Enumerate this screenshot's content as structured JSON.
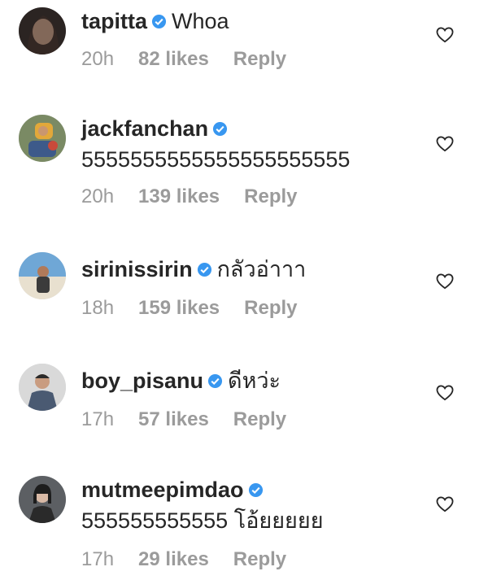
{
  "comments": [
    {
      "username": "tapitta",
      "text_inline": "Whoa",
      "text_below": "",
      "time": "20h",
      "likes": "82 likes",
      "reply": "Reply"
    },
    {
      "username": "jackfanchan",
      "text_inline": "",
      "text_below": "5555555555555555555555",
      "time": "20h",
      "likes": "139 likes",
      "reply": "Reply"
    },
    {
      "username": "sirinissirin",
      "text_inline": "กลัวอ่าาา",
      "text_below": "",
      "time": "18h",
      "likes": "159 likes",
      "reply": "Reply"
    },
    {
      "username": "boy_pisanu",
      "text_inline": "ดีหว่ะ",
      "text_below": "",
      "time": "17h",
      "likes": "57 likes",
      "reply": "Reply"
    },
    {
      "username": "mutmeepimdao",
      "text_inline": "",
      "text_below": "555555555555 โอ้ยยยยย",
      "time": "17h",
      "likes": "29 likes",
      "reply": "Reply"
    }
  ],
  "icons": {
    "verified": "verified-badge-icon",
    "like": "heart-outline-icon"
  },
  "colors": {
    "verified": "#3897f0",
    "meta": "#9b9b9b",
    "text": "#262626"
  }
}
